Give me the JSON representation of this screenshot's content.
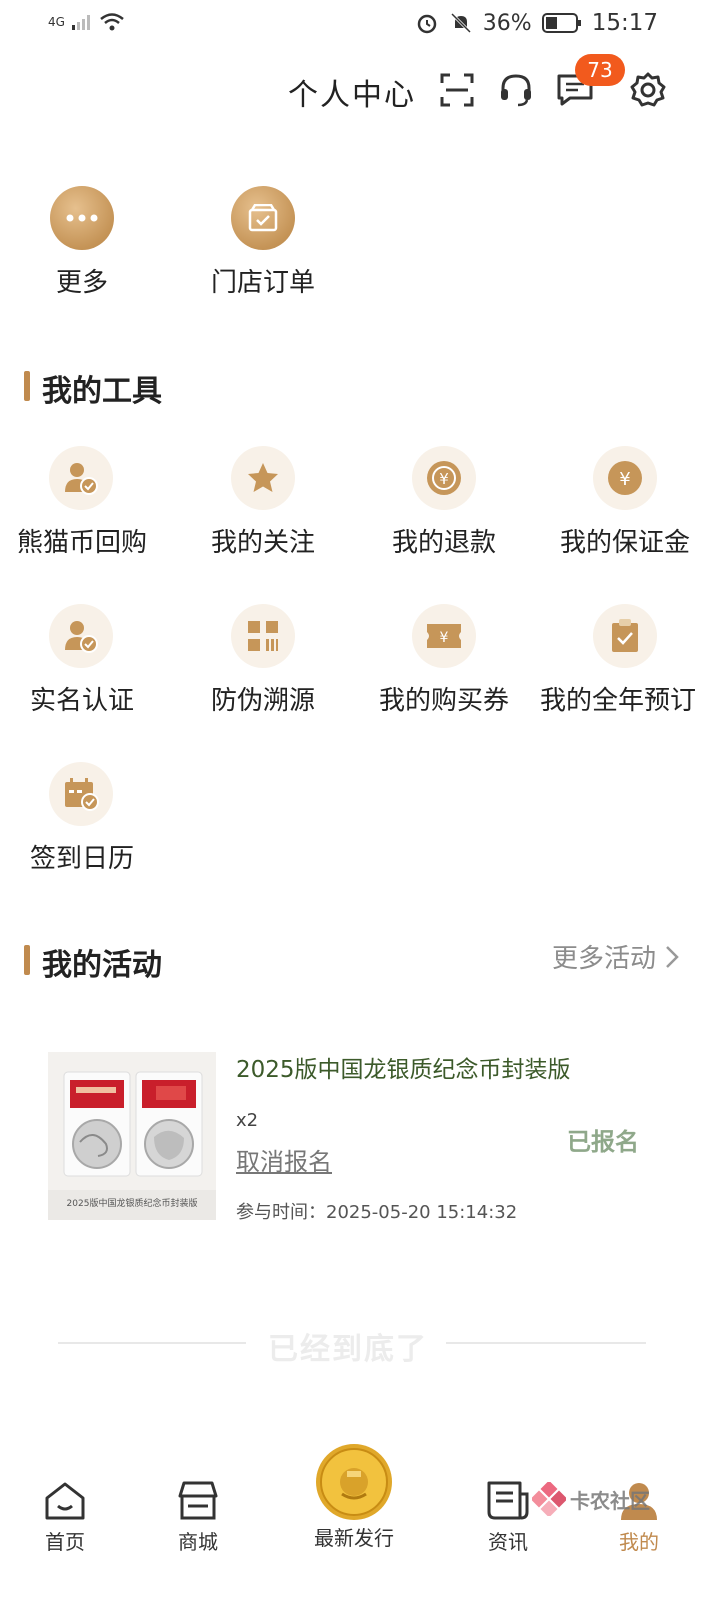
{
  "status": {
    "network": "4G",
    "battery": "36%",
    "time": "15:17"
  },
  "header": {
    "title": "个人中心",
    "badge_count": "73"
  },
  "quick_actions": [
    {
      "label": "更多",
      "icon": "more-dots-icon"
    },
    {
      "label": "门店订单",
      "icon": "store-order-icon"
    }
  ],
  "tools": {
    "title": "我的工具",
    "items": [
      {
        "label": "熊猫币回购",
        "icon": "user-check-icon"
      },
      {
        "label": "我的关注",
        "icon": "star-icon"
      },
      {
        "label": "我的退款",
        "icon": "refund-yen-icon"
      },
      {
        "label": "我的保证金",
        "icon": "deposit-yen-icon"
      },
      {
        "label": "实名认证",
        "icon": "real-name-icon"
      },
      {
        "label": "防伪溯源",
        "icon": "anti-counterfeit-icon"
      },
      {
        "label": "我的购买券",
        "icon": "coupon-icon"
      },
      {
        "label": "我的全年预订",
        "icon": "clipboard-check-icon"
      },
      {
        "label": "签到日历",
        "icon": "calendar-check-icon"
      }
    ]
  },
  "activities": {
    "title": "我的活动",
    "more": "更多活动",
    "item": {
      "title": "2025版中国龙银质纪念币封装版",
      "qty": "x2",
      "cancel": "取消报名",
      "status": "已报名",
      "time_label": "参与时间：",
      "time": "2025-05-20 15:14:32",
      "image_caption": "2025版中国龙银质纪念币封装版"
    }
  },
  "footer_text": "已经到底了",
  "tabbar": {
    "items": [
      {
        "label": "首页",
        "icon": "home-icon"
      },
      {
        "label": "商城",
        "icon": "shop-icon"
      },
      {
        "label": "最新发行",
        "icon": "gold-coin-icon"
      },
      {
        "label": "资讯",
        "icon": "news-icon"
      },
      {
        "label": "我的",
        "icon": "profile-icon"
      }
    ],
    "active_color": "#c08a4e"
  },
  "watermark": "卡农社区"
}
